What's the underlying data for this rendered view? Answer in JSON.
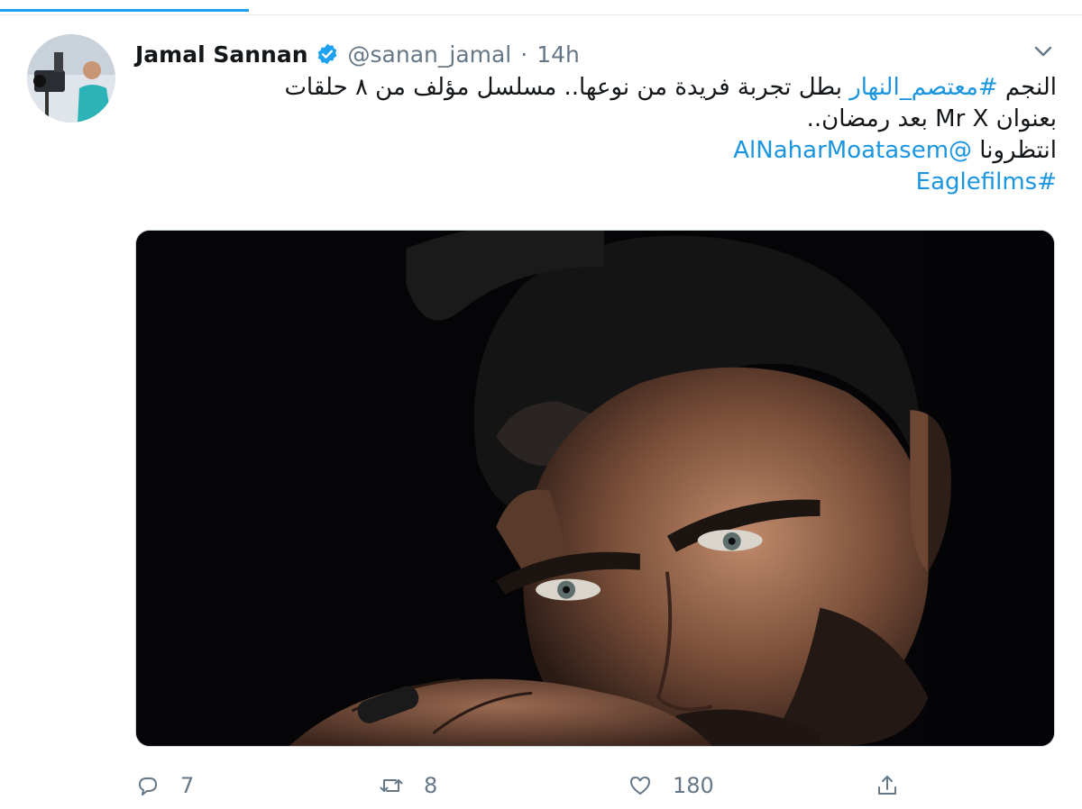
{
  "tweet": {
    "author_name": "Jamal Sannan",
    "author_handle": "@sanan_jamal",
    "separator": "·",
    "time": "14h",
    "text": {
      "line1_prefix": "النجم ",
      "hashtag1": "#معتصم_النهار",
      "line1_suffix": " بطل تجربة فريدة من نوعها.. مسلسل مؤلف من ٨ حلقات",
      "line2": "بعنوان Mr X بعد رمضان..",
      "line3_prefix": "انتظرونا ",
      "mention": "@AlNaharMoatasem",
      "hashtag2": "#Eaglefilms"
    }
  },
  "actions": {
    "reply_count": "7",
    "retweet_count": "8",
    "like_count": "180"
  },
  "colors": {
    "accent": "#1da1f2",
    "link": "#1b95e0",
    "muted": "#657786",
    "text": "#14171a"
  },
  "icons": {
    "verified": "verified-badge-icon",
    "chevron": "chevron-down-icon",
    "reply": "reply-icon",
    "retweet": "retweet-icon",
    "like": "heart-icon",
    "share": "share-icon"
  }
}
